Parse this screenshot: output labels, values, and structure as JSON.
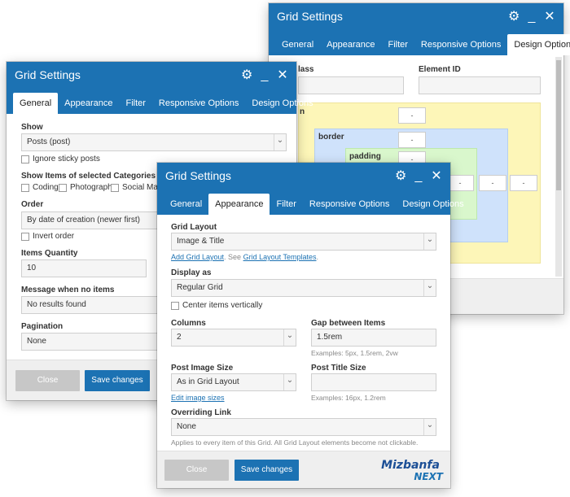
{
  "back": {
    "title": "Grid Settings",
    "tabs": [
      "General",
      "Appearance",
      "Filter",
      "Responsive Options",
      "Design Options"
    ],
    "active_tab": "Design Options",
    "class_label": "lass",
    "element_id_label": "Element ID",
    "margin_label": "n",
    "border_label": "border",
    "padding_label": "padding",
    "dash": "-"
  },
  "mid": {
    "title": "Grid Settings",
    "tabs": [
      "General",
      "Appearance",
      "Filter",
      "Responsive Options",
      "Design Options"
    ],
    "active_tab": "General",
    "show_label": "Show",
    "show_value": "Posts (post)",
    "ignore_sticky": "Ignore sticky posts",
    "cat_label": "Show Items of selected Categories",
    "cat_coding": "Coding",
    "cat_photography": "Photography",
    "cat_social": "Social Marke",
    "order_label": "Order",
    "order_value": "By date of creation (newer first)",
    "invert_order": "Invert order",
    "qty_label": "Items Quantity",
    "qty_value": "10",
    "noitems_label": "Message when no items",
    "noitems_value": "No results found",
    "pagination_label": "Pagination",
    "pagination_value": "None",
    "close_label": "Close",
    "save_label": "Save changes"
  },
  "front": {
    "title": "Grid Settings",
    "tabs": [
      "General",
      "Appearance",
      "Filter",
      "Responsive Options",
      "Design Options"
    ],
    "active_tab": "Appearance",
    "grid_layout_label": "Grid Layout",
    "grid_layout_value": "Image & Title",
    "add_grid_layout": "Add Grid Layout",
    "see_text": ". See",
    "grid_layout_templates": "Grid Layout Templates",
    "period": ".",
    "display_as_label": "Display as",
    "display_as_value": "Regular Grid",
    "center_vertically": "Center items vertically",
    "columns_label": "Columns",
    "columns_value": "2",
    "gap_label": "Gap between Items",
    "gap_value": "1.5rem",
    "gap_hint": "Examples: 5px, 1.5rem, 2vw",
    "image_size_label": "Post Image Size",
    "image_size_value": "As in Grid Layout",
    "edit_image_sizes": "Edit image sizes",
    "title_size_label": "Post Title Size",
    "title_size_value": "",
    "title_size_hint": "Examples: 16px, 1.2rem",
    "overriding_label": "Overriding Link",
    "overriding_value": "None",
    "overriding_hint": "Applies to every item of this Grid. All Grid Layout elements become not clickable.",
    "close_label": "Close",
    "save_label": "Save changes"
  },
  "watermark": {
    "line1": "Mizbanfa",
    "line2": "NEXT"
  },
  "colors": {
    "accent": "#1c72b3",
    "margin_box": "#fdf6b8",
    "border_box": "#cfe2fb",
    "padding_box": "#d9f7cc"
  }
}
